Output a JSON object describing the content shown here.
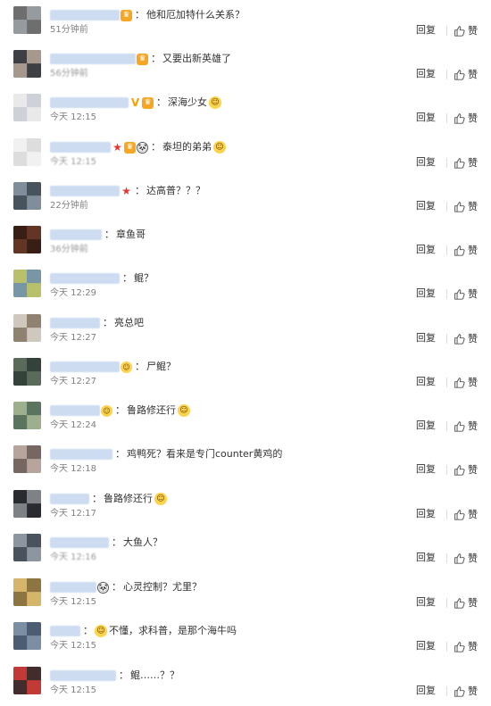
{
  "actions": {
    "reply_label": "回复",
    "like_label": "赞"
  },
  "comments": [
    {
      "badges": [
        "vip"
      ],
      "text": "他和厄加特什么关系？",
      "time": "51分钟前"
    },
    {
      "badges": [
        "vip"
      ],
      "text": "又要出新英雄了",
      "time": "56分钟前"
    },
    {
      "badges": [
        "v",
        "vip"
      ],
      "text": "深海少女",
      "trail_emoji": "face-emoji",
      "time": "今天 12:15"
    },
    {
      "badges": [
        "star",
        "vip",
        "panda"
      ],
      "text": "泰坦的弟弟",
      "trail_emoji": "face-emoji",
      "time": "今天 12:15"
    },
    {
      "badges": [
        "star"
      ],
      "text": "达高普？？？",
      "time": "22分钟前"
    },
    {
      "badges": [],
      "text": "章鱼哥",
      "time": "36分钟前"
    },
    {
      "badges": [],
      "text": "鲲？",
      "time": "今天 12:29"
    },
    {
      "badges": [],
      "text": "亮总吧",
      "time": "今天 12:27"
    },
    {
      "badges": [
        "smile"
      ],
      "text": "尸鲲？",
      "time": "今天 12:27"
    },
    {
      "badges": [
        "smile"
      ],
      "text": "鲁路修还行",
      "trail_emoji": "face-emoji",
      "time": "今天 12:24"
    },
    {
      "badges": [],
      "text": "鸡鸭死？看来是专门counter黄鸡的",
      "time": "今天 12:18"
    },
    {
      "badges": [],
      "text": "鲁路修还行",
      "trail_emoji": "face-emoji",
      "time": "今天 12:17"
    },
    {
      "badges": [],
      "text": "大鱼人？",
      "time": "今天 12:16"
    },
    {
      "badges": [
        "panda"
      ],
      "text": "心灵控制？尤里？",
      "time": "今天 12:15"
    },
    {
      "badges": [],
      "lead_emoji": "face-emoji",
      "text": "不懂，求科普，是那个海牛吗",
      "time": "今天 12:15"
    },
    {
      "badges": [],
      "text": "鲲……？？",
      "time": "今天 12:15"
    }
  ]
}
